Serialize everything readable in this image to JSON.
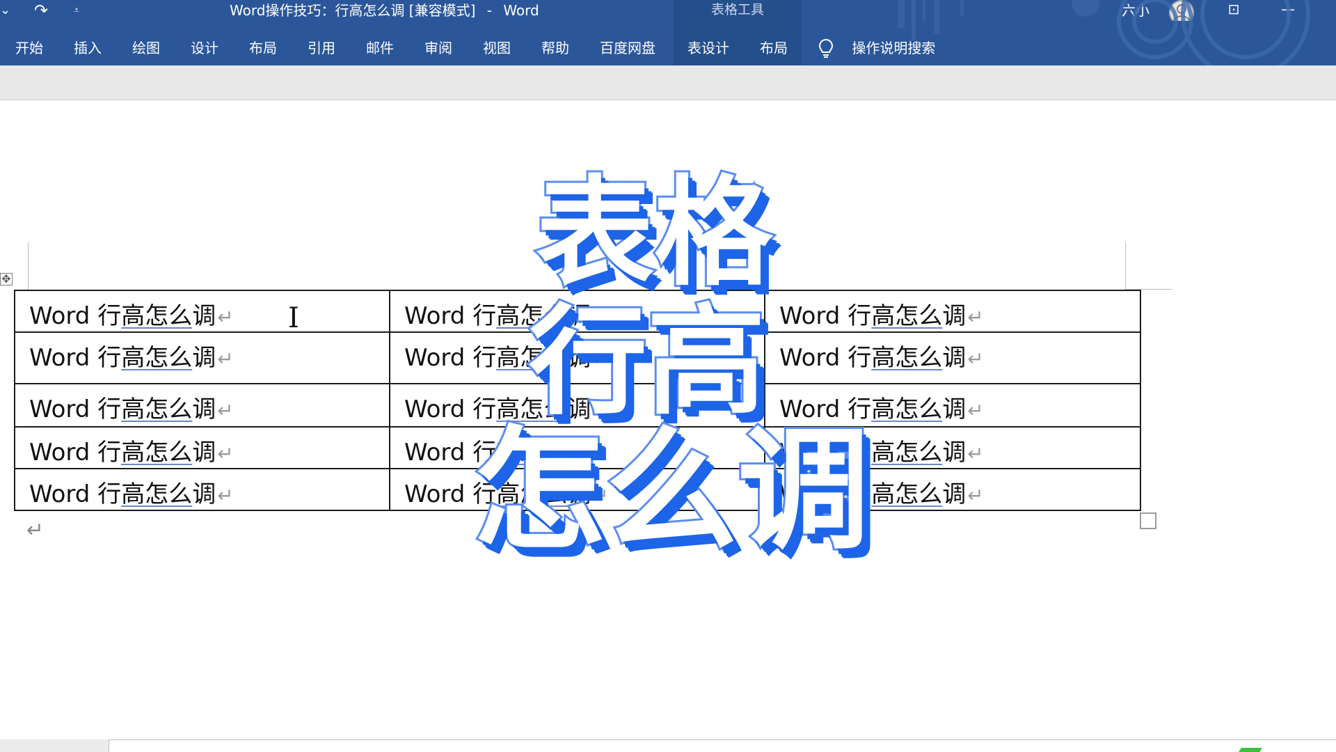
{
  "titlebar": {
    "quick_access": {
      "undo_dropdown": "⌄",
      "redo": "↷",
      "customize": "⩡"
    },
    "document_title": "Word操作技巧：行高怎么调 [兼容模式]",
    "separator": "-",
    "app_name": "Word",
    "context_group": "表格工具",
    "user_name": "六小",
    "window_buttons": {
      "ribbon_display": "⊡",
      "minimize": "—"
    }
  },
  "ribbon": {
    "tabs": [
      {
        "label": "开始"
      },
      {
        "label": "插入"
      },
      {
        "label": "绘图"
      },
      {
        "label": "设计"
      },
      {
        "label": "布局"
      },
      {
        "label": "引用"
      },
      {
        "label": "邮件"
      },
      {
        "label": "审阅"
      },
      {
        "label": "视图"
      },
      {
        "label": "帮助"
      },
      {
        "label": "百度网盘"
      }
    ],
    "context_tabs": [
      {
        "label": "表设计"
      },
      {
        "label": "布局"
      }
    ],
    "tell_me": "操作说明搜索"
  },
  "document": {
    "table": {
      "rows": [
        [
          {
            "prefix": "Word 行",
            "underlined": "高怎么",
            "suffix": "调",
            "mark": "↵"
          },
          {
            "prefix": "Word 行",
            "underlined": "高怎么",
            "suffix": "调",
            "mark": "↵"
          },
          {
            "prefix": "Word 行",
            "underlined": "高怎么",
            "suffix": "调",
            "mark": "↵"
          }
        ],
        [
          {
            "prefix": "Word 行",
            "underlined": "高怎么",
            "suffix": "调",
            "mark": "↵"
          },
          {
            "prefix": "Word 行",
            "underlined": "高怎么",
            "suffix": "调",
            "mark": "↵"
          },
          {
            "prefix": "Word 行",
            "underlined": "高怎么",
            "suffix": "调",
            "mark": "↵"
          }
        ],
        [
          {
            "prefix": "Word 行",
            "underlined": "高怎么",
            "suffix": "调",
            "mark": "↵"
          },
          {
            "prefix": "Word 行",
            "underlined": "高怎么",
            "suffix": "调",
            "mark": "↵"
          },
          {
            "prefix": "Word 行",
            "underlined": "高怎么",
            "suffix": "调",
            "mark": "↵"
          }
        ],
        [
          {
            "prefix": "Word 行",
            "underlined": "高怎么",
            "suffix": "调",
            "mark": "↵"
          },
          {
            "prefix": "Word 行",
            "underlined": "高怎么",
            "suffix": "调",
            "mark": "↵"
          },
          {
            "prefix": "Word 行",
            "underlined": "高怎么",
            "suffix": "调",
            "mark": "↵"
          }
        ],
        [
          {
            "prefix": "Word 行",
            "underlined": "高怎么",
            "suffix": "调",
            "mark": "↵"
          },
          {
            "prefix": "Word 行",
            "underlined": "高怎么",
            "suffix": "调",
            "mark": "↵"
          },
          {
            "prefix": "Word 行",
            "underlined": "高怎么",
            "suffix": "调",
            "mark": "↵"
          }
        ]
      ]
    },
    "move_handle": "✥",
    "paragraph_mark": "↵",
    "cursor": "I"
  },
  "overlay": {
    "line_1": "表格",
    "line_2": "行高",
    "line_3": "怎么调"
  },
  "colors": {
    "ribbon": "#2b579a",
    "context_tab": "#244f8b",
    "overlay_fill": "#ffffff",
    "overlay_shadow": "#1d64e8"
  }
}
